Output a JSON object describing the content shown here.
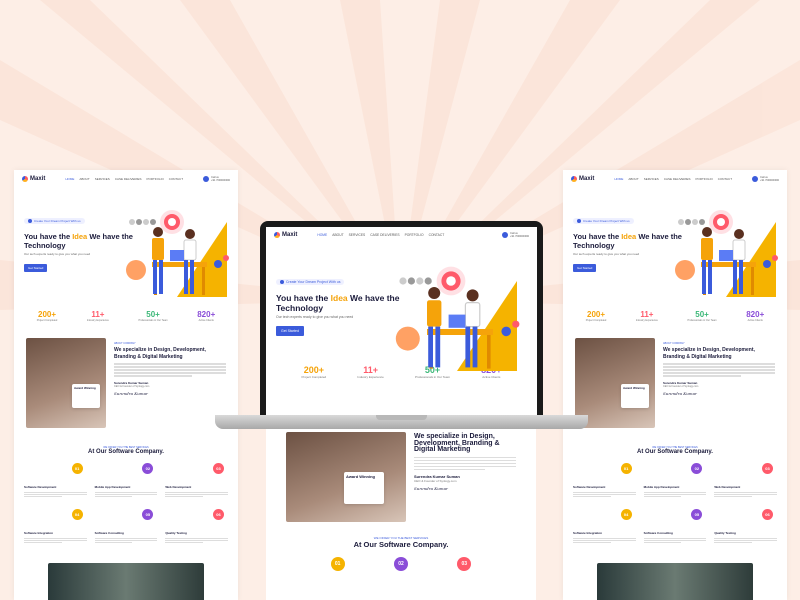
{
  "colors": {
    "accent": "#3b5bdb",
    "highlight": "#f5a30a",
    "background": "#fdeee6"
  },
  "logo": "Maxit",
  "nav": {
    "items": [
      "HOME",
      "ABOUT",
      "SERVICES",
      "CASE DELIVERIES",
      "PORTFOLIO",
      "CONTACT"
    ],
    "contact_label": "Call us",
    "phone": "+91 7000000000"
  },
  "hero": {
    "pill": "Create Your Dream Project With us",
    "title_pre": "You have the ",
    "title_highlight": "Idea",
    "title_post": " We have the Technology",
    "subtitle": "Our tech experts ready to give you what you need",
    "cta": "Get Started"
  },
  "stats": [
    {
      "num": "200+",
      "label": "Project Completed"
    },
    {
      "num": "11+",
      "label": "Industry Experience"
    },
    {
      "num": "50+",
      "label": "Professionals in Our Team"
    },
    {
      "num": "820+",
      "label": "Active Clients"
    }
  ],
  "about": {
    "kicker": "ABOUT COMPANY",
    "title": "We specialize in Design, Development, Branding & Digital Marketing",
    "award": "Award Winning",
    "person_name": "Surendra Kumar Suman",
    "person_role": "CEO & Founder of Synlogy.com",
    "signature": "Surendra Kumar"
  },
  "services": {
    "kicker": "WE OFFER YOU THE BEST SERVICES",
    "title": "At Our Software Company.",
    "items": [
      {
        "num": "01",
        "name": "Software Development",
        "color": "#f5b300"
      },
      {
        "num": "02",
        "name": "Mobile App Development",
        "color": "#8a4dd8"
      },
      {
        "num": "03",
        "name": "Web Development",
        "color": "#ff5a6a"
      },
      {
        "num": "04",
        "name": "Software Integration",
        "color": "#f5b300"
      },
      {
        "num": "05",
        "name": "Software Consulting",
        "color": "#8a4dd8"
      },
      {
        "num": "06",
        "name": "Quality Testing",
        "color": "#ff5a6a"
      }
    ]
  }
}
